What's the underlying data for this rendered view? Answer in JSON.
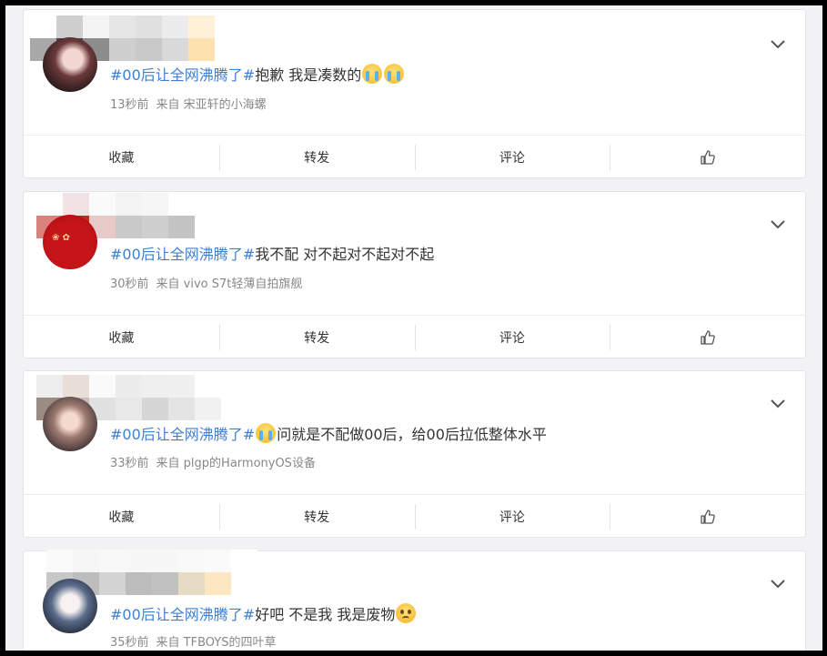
{
  "posts": [
    {
      "topic": "#00后让全网沸腾了#",
      "text_before": "抱歉 我是凑数的",
      "emojis": [
        "crying-face",
        "crying-face"
      ],
      "text_after": "",
      "time": "13秒前",
      "source": "来自 宋亚轩的小海螺"
    },
    {
      "topic": "#00后让全网沸腾了#",
      "text_before": "我不配 对不起对不起对不起",
      "emojis": [],
      "text_after": "",
      "time": "30秒前",
      "source": "来自 vivo S7t轻薄自拍旗舰"
    },
    {
      "topic": "#00后让全网沸腾了#",
      "text_before": "",
      "emojis": [
        "loudly-crying-face"
      ],
      "text_after": "问就是不配做00后，给00后拉低整体水平",
      "time": "33秒前",
      "source": "来自 plgp的HarmonyOS设备"
    },
    {
      "topic": "#00后让全网沸腾了#",
      "text_before": "好吧 不是我 我是废物",
      "emojis": [
        "pleading-face"
      ],
      "text_after": "",
      "time": "35秒前",
      "source": "来自 TFBOYS的四叶草"
    }
  ],
  "actions": {
    "favorite": "收藏",
    "repost": "转发",
    "comment": "评论",
    "like_icon": "thumbs-up-icon"
  },
  "colors": {
    "topic": "#3e7fcf",
    "background": "#f2f2f5"
  }
}
